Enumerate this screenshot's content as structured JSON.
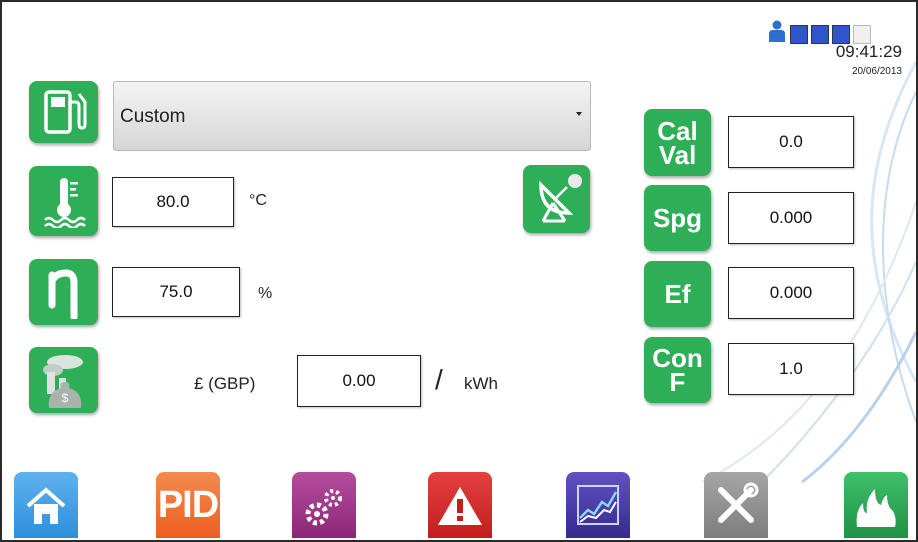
{
  "status": {
    "time": "09:41:29",
    "date": "20/06/2013",
    "signal_bars": 4,
    "signal_bars_active": 3
  },
  "fuel": {
    "selected": "Custom"
  },
  "temperature": {
    "value": "80.0",
    "unit": "°C"
  },
  "efficiency": {
    "value": "75.0",
    "unit": "%"
  },
  "cost": {
    "currency_label": "£ (GBP)",
    "value": "0.00",
    "separator": "/",
    "unit": "kWh"
  },
  "side": {
    "cal_val": {
      "line1": "Cal",
      "line2": "Val",
      "value": "0.0"
    },
    "spg": {
      "label": "Spg",
      "value": "0.000"
    },
    "ef": {
      "label": "Ef",
      "value": "0.000"
    },
    "con_f": {
      "line1": "Con",
      "line2": "F",
      "value": "1.0"
    }
  },
  "nav": {
    "pid_label": "PID"
  },
  "colors": {
    "accent_green": "#2fae58",
    "home_blue": "#2d8fdc",
    "pid_orange": "#f06a2a",
    "settings_purple": "#9b2f82",
    "alarm_red": "#d42a2a",
    "trend_indigo": "#3e2f9e",
    "tools_grey": "#8e8e8e"
  },
  "icons": [
    "user-icon",
    "fuel-pump-icon",
    "thermometer-water-icon",
    "eta-icon",
    "money-pollution-icon",
    "satellite-dish-icon",
    "home-icon",
    "gears-icon",
    "warning-icon",
    "trend-chart-icon",
    "tools-icon",
    "flame-icon"
  ]
}
